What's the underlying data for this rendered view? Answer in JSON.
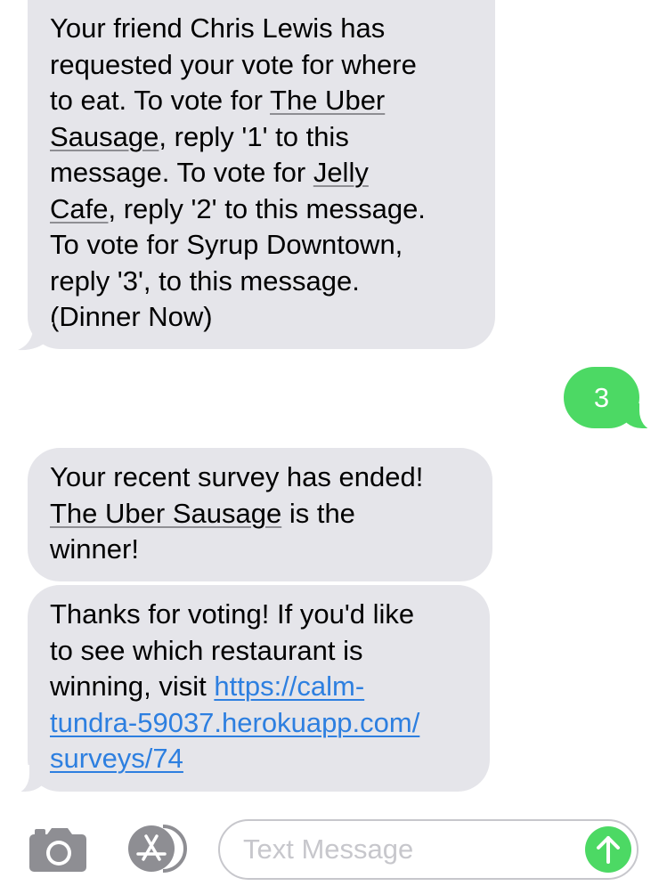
{
  "messages": [
    {
      "direction": "received",
      "lines": [
        [
          {
            "text": "Your friend Chris Lewis has"
          }
        ],
        [
          {
            "text": "requested your vote for where"
          }
        ],
        [
          {
            "text": "to eat. To vote for "
          },
          {
            "text": "The Uber",
            "style": "underline"
          }
        ],
        [
          {
            "text": "Sausage",
            "style": "underline"
          },
          {
            "text": ", reply '1' to this"
          }
        ],
        [
          {
            "text": "message. To vote for "
          },
          {
            "text": "Jelly",
            "style": "underline"
          }
        ],
        [
          {
            "text": "Cafe",
            "style": "underline"
          },
          {
            "text": ", reply '2' to this message."
          }
        ],
        [
          {
            "text": "To vote for Syrup Downtown,"
          }
        ],
        [
          {
            "text": "reply '3', to this message."
          }
        ],
        [
          {
            "text": "(Dinner Now)"
          }
        ]
      ]
    },
    {
      "direction": "sent",
      "text": "3"
    },
    {
      "direction": "received",
      "lines": [
        [
          {
            "text": "Your recent survey has ended!"
          }
        ],
        [
          {
            "text": "The Uber Sausage",
            "style": "underline"
          },
          {
            "text": " is the"
          }
        ],
        [
          {
            "text": "winner!"
          }
        ]
      ]
    },
    {
      "direction": "received",
      "lines": [
        [
          {
            "text": "Thanks for voting! If you'd like"
          }
        ],
        [
          {
            "text": "to see which restaurant is"
          }
        ],
        [
          {
            "text": "winning, visit "
          },
          {
            "text": "https://calm-",
            "style": "link"
          }
        ],
        [
          {
            "text": "tundra-59037.herokuapp.com/",
            "style": "link"
          }
        ],
        [
          {
            "text": "surveys/74",
            "style": "link"
          }
        ]
      ]
    }
  ],
  "composer": {
    "placeholder": "Text Message",
    "camera_icon": "camera-icon",
    "apps_icon": "app-store-icon",
    "send_icon": "send-arrow-up-icon"
  },
  "colors": {
    "received_bubble": "#e5e5ea",
    "sent_bubble": "#4cd964",
    "link": "#2d7fe0",
    "placeholder": "#c7c7cc"
  }
}
